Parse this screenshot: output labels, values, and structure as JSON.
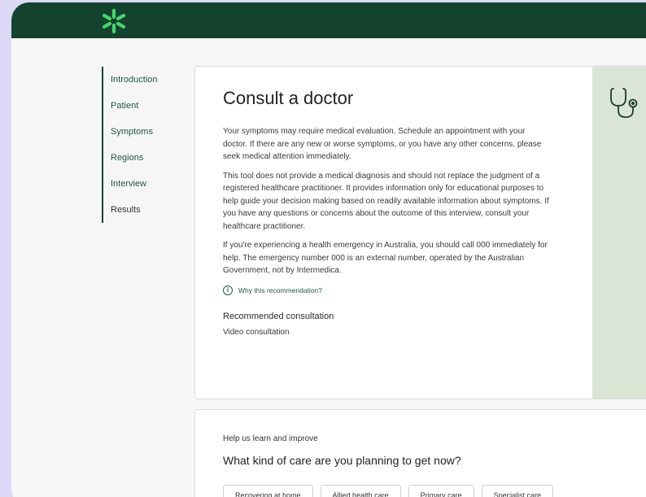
{
  "header": {
    "logo_icon": "asterisk-logo-icon",
    "background": "#13432f",
    "accent": "#4bd36b"
  },
  "sidebar": {
    "items": [
      {
        "label": "Introduction"
      },
      {
        "label": "Patient"
      },
      {
        "label": "Symptoms"
      },
      {
        "label": "Regions"
      },
      {
        "label": "Interview"
      },
      {
        "label": "Results",
        "active": true
      }
    ]
  },
  "result": {
    "title": "Consult a doctor",
    "icon": "stethoscope-icon",
    "paragraphs": [
      "Your symptoms may require medical evaluation. Schedule an appointment with your doctor. If there are any new or worse symptoms, or you have any other concerns, please seek medical attention immediately.",
      "This tool does not provide a medical diagnosis and should not replace the judgment of a registered healthcare practitioner. It provides information only for educational purposes to help guide your decision making based on readily available information about symptoms. If you have any questions or concerns about the outcome of this interview, consult your healthcare practitioner.",
      "If you're experiencing a health emergency in Australia, you should call 000 immediately for help. The emergency number 000 is an external number, operated by the Australian Government, not by Intermedica."
    ],
    "why_label": "Why this recommendation?",
    "recommended_title": "Recommended consultation",
    "recommended_value": "Video consultation"
  },
  "feedback": {
    "intro": "Help us learn and improve",
    "question": "What kind of care are you planning to get now?",
    "options": [
      "Recovering at home",
      "Allied health care",
      "Primary care",
      "Specialist care"
    ]
  }
}
